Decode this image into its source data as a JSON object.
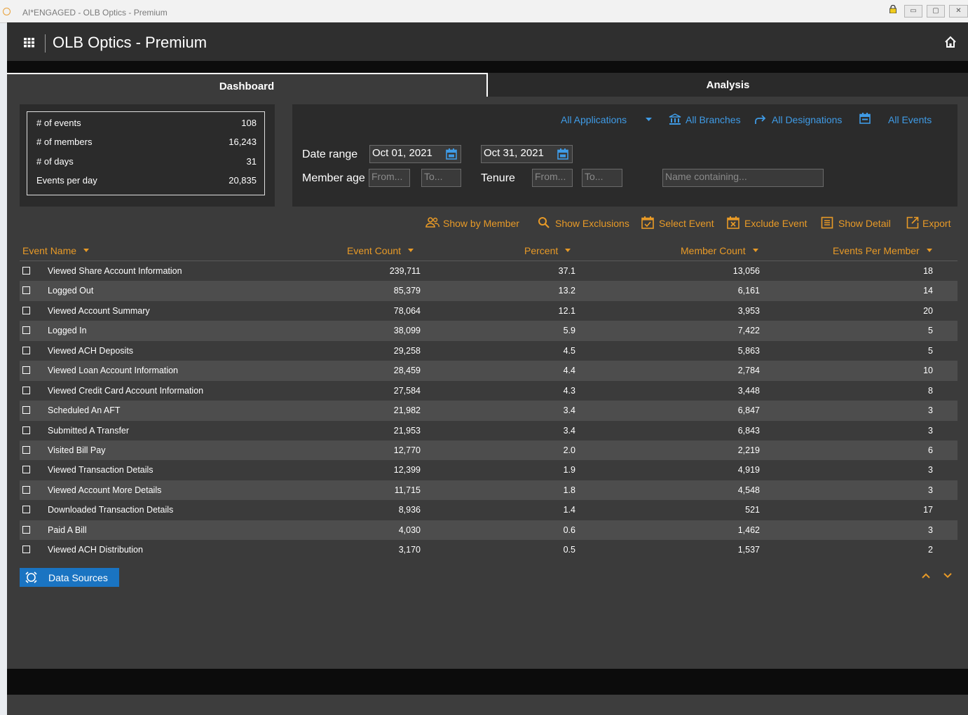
{
  "window": {
    "title": "AI*ENGAGED - OLB Optics - Premium",
    "minimize": "▭",
    "maximize": "▢",
    "close": "✕"
  },
  "header": {
    "title": "OLB Optics - Premium"
  },
  "tabs": {
    "dashboard": "Dashboard",
    "analysis": "Analysis"
  },
  "stats": [
    {
      "label": "# of events",
      "value": "108"
    },
    {
      "label": "# of members",
      "value": "16,243"
    },
    {
      "label": "# of days",
      "value": "31"
    },
    {
      "label": "Events per day",
      "value": "20,835"
    }
  ],
  "filters": {
    "applications": "All Applications",
    "branches": "All Branches",
    "designations": "All Designations",
    "events": "All Events",
    "date_range_label": "Date range",
    "date_from": "Oct 01, 2021",
    "date_to": "Oct 31, 2021",
    "member_age_label": "Member age",
    "age_from_placeholder": "From...",
    "age_to_placeholder": "To...",
    "tenure_label": "Tenure",
    "tenure_from_placeholder": "From...",
    "tenure_to_placeholder": "To...",
    "name_placeholder": "Name containing..."
  },
  "actions": {
    "show_by_member": "Show by Member",
    "show_exclusions": "Show Exclusions",
    "select_event": "Select Event",
    "exclude_event": "Exclude Event",
    "show_detail": "Show Detail",
    "export": "Export"
  },
  "table": {
    "columns": {
      "event_name": "Event Name",
      "event_count": "Event Count",
      "percent": "Percent",
      "member_count": "Member Count",
      "events_per_member": "Events Per Member"
    },
    "rows": [
      {
        "name": "Viewed Share Account Information",
        "count": "239,711",
        "percent": "37.1",
        "members": "13,056",
        "epm": "18"
      },
      {
        "name": "Logged Out",
        "count": "85,379",
        "percent": "13.2",
        "members": "6,161",
        "epm": "14"
      },
      {
        "name": "Viewed Account Summary",
        "count": "78,064",
        "percent": "12.1",
        "members": "3,953",
        "epm": "20"
      },
      {
        "name": "Logged In",
        "count": "38,099",
        "percent": "5.9",
        "members": "7,422",
        "epm": "5"
      },
      {
        "name": "Viewed ACH Deposits",
        "count": "29,258",
        "percent": "4.5",
        "members": "5,863",
        "epm": "5"
      },
      {
        "name": "Viewed Loan Account Information",
        "count": "28,459",
        "percent": "4.4",
        "members": "2,784",
        "epm": "10"
      },
      {
        "name": "Viewed Credit Card Account Information",
        "count": "27,584",
        "percent": "4.3",
        "members": "3,448",
        "epm": "8"
      },
      {
        "name": "Scheduled An AFT",
        "count": "21,982",
        "percent": "3.4",
        "members": "6,847",
        "epm": "3"
      },
      {
        "name": "Submitted A Transfer",
        "count": "21,953",
        "percent": "3.4",
        "members": "6,843",
        "epm": "3"
      },
      {
        "name": "Visited Bill Pay",
        "count": "12,770",
        "percent": "2.0",
        "members": "2,219",
        "epm": "6"
      },
      {
        "name": "Viewed Transaction Details",
        "count": "12,399",
        "percent": "1.9",
        "members": "4,919",
        "epm": "3"
      },
      {
        "name": "Viewed Account More Details",
        "count": "11,715",
        "percent": "1.8",
        "members": "4,548",
        "epm": "3"
      },
      {
        "name": "Downloaded Transaction Details",
        "count": "8,936",
        "percent": "1.4",
        "members": "521",
        "epm": "17"
      },
      {
        "name": "Paid A Bill",
        "count": "4,030",
        "percent": "0.6",
        "members": "1,462",
        "epm": "3"
      },
      {
        "name": "Viewed ACH Distribution",
        "count": "3,170",
        "percent": "0.5",
        "members": "1,537",
        "epm": "2"
      }
    ]
  },
  "data_sources": {
    "label": "Data Sources"
  },
  "colors": {
    "accent_orange": "#e89a27",
    "link_blue": "#3f9be6",
    "button_blue": "#1a74c2",
    "panel_bg": "#2b2b2b",
    "frame_bg": "#3b3b3b"
  }
}
